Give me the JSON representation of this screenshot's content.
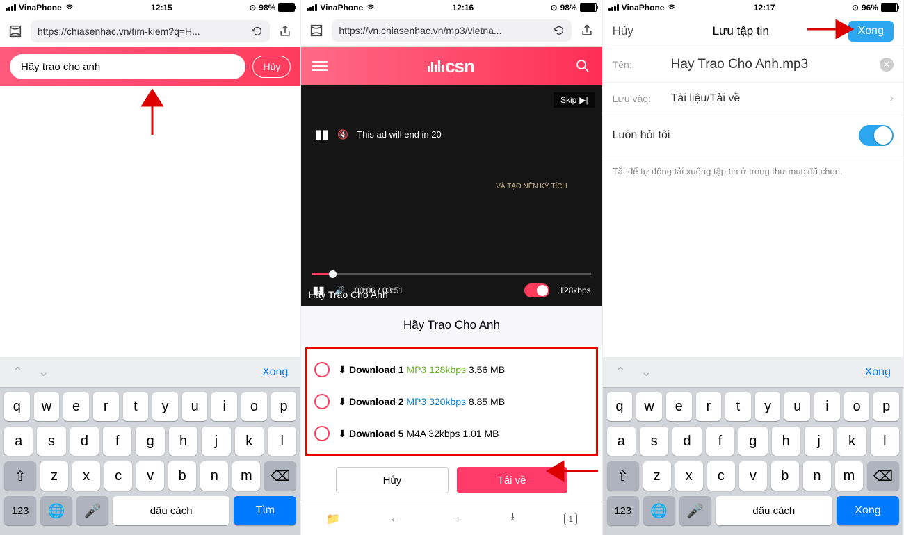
{
  "status": {
    "carrier": "VinaPhone",
    "t1": "12:15",
    "t2": "12:16",
    "t3": "12:17",
    "b1": "98%",
    "b2": "98%",
    "b3": "96%",
    "orient": "⊙"
  },
  "p1": {
    "url": "https://chiasenhac.vn/tim-kiem?q=H...",
    "search_value": "Hãy trao cho anh",
    "cancel": "Hủy",
    "kb_done": "Xong",
    "space": "dấu cách",
    "action": "Tìm",
    "num": "123"
  },
  "p2": {
    "url": "https://vn.chiasenhac.vn/mp3/vietna...",
    "logo": "csn",
    "skip": "Skip",
    "ad": "This ad will end in 20",
    "ad_overlay": "VÀ TẠO NÊN KỲ TÍCH",
    "time": "00:06 / 03:51",
    "quality": "128kbps",
    "song_label": "Hãy Trao Cho Anh",
    "title": "Hãy Trao Cho Anh",
    "dl": [
      {
        "n": "Download 1",
        "fmt": "MP3 128kbps",
        "cls": "green",
        "size": "3.56 MB"
      },
      {
        "n": "Download 2",
        "fmt": "MP3 320kbps",
        "cls": "blue",
        "size": "8.85 MB"
      },
      {
        "n": "Download 5",
        "fmt": "M4A 32kbps",
        "cls": "",
        "size": "1.01 MB"
      }
    ],
    "cancel": "Hủy",
    "download": "Tải về"
  },
  "p3": {
    "cancel": "Hủy",
    "title": "Lưu tập tin",
    "done": "Xong",
    "name_lbl": "Tên:",
    "name_val": "Hay Trao Cho Anh.mp3",
    "save_lbl": "Lưu vào:",
    "save_val": "Tài liệu/Tải về",
    "ask": "Luôn hỏi tôi",
    "helper": "Tắt để tự động tải xuống tập tin ở trong thư mục đã chọn.",
    "space": "dấu cách",
    "action": "Xong",
    "num": "123"
  },
  "rows": {
    "r1": [
      "q",
      "w",
      "e",
      "r",
      "t",
      "y",
      "u",
      "i",
      "o",
      "p"
    ],
    "r2": [
      "a",
      "s",
      "d",
      "f",
      "g",
      "h",
      "j",
      "k",
      "l"
    ],
    "r3": [
      "z",
      "x",
      "c",
      "v",
      "b",
      "n",
      "m"
    ]
  }
}
